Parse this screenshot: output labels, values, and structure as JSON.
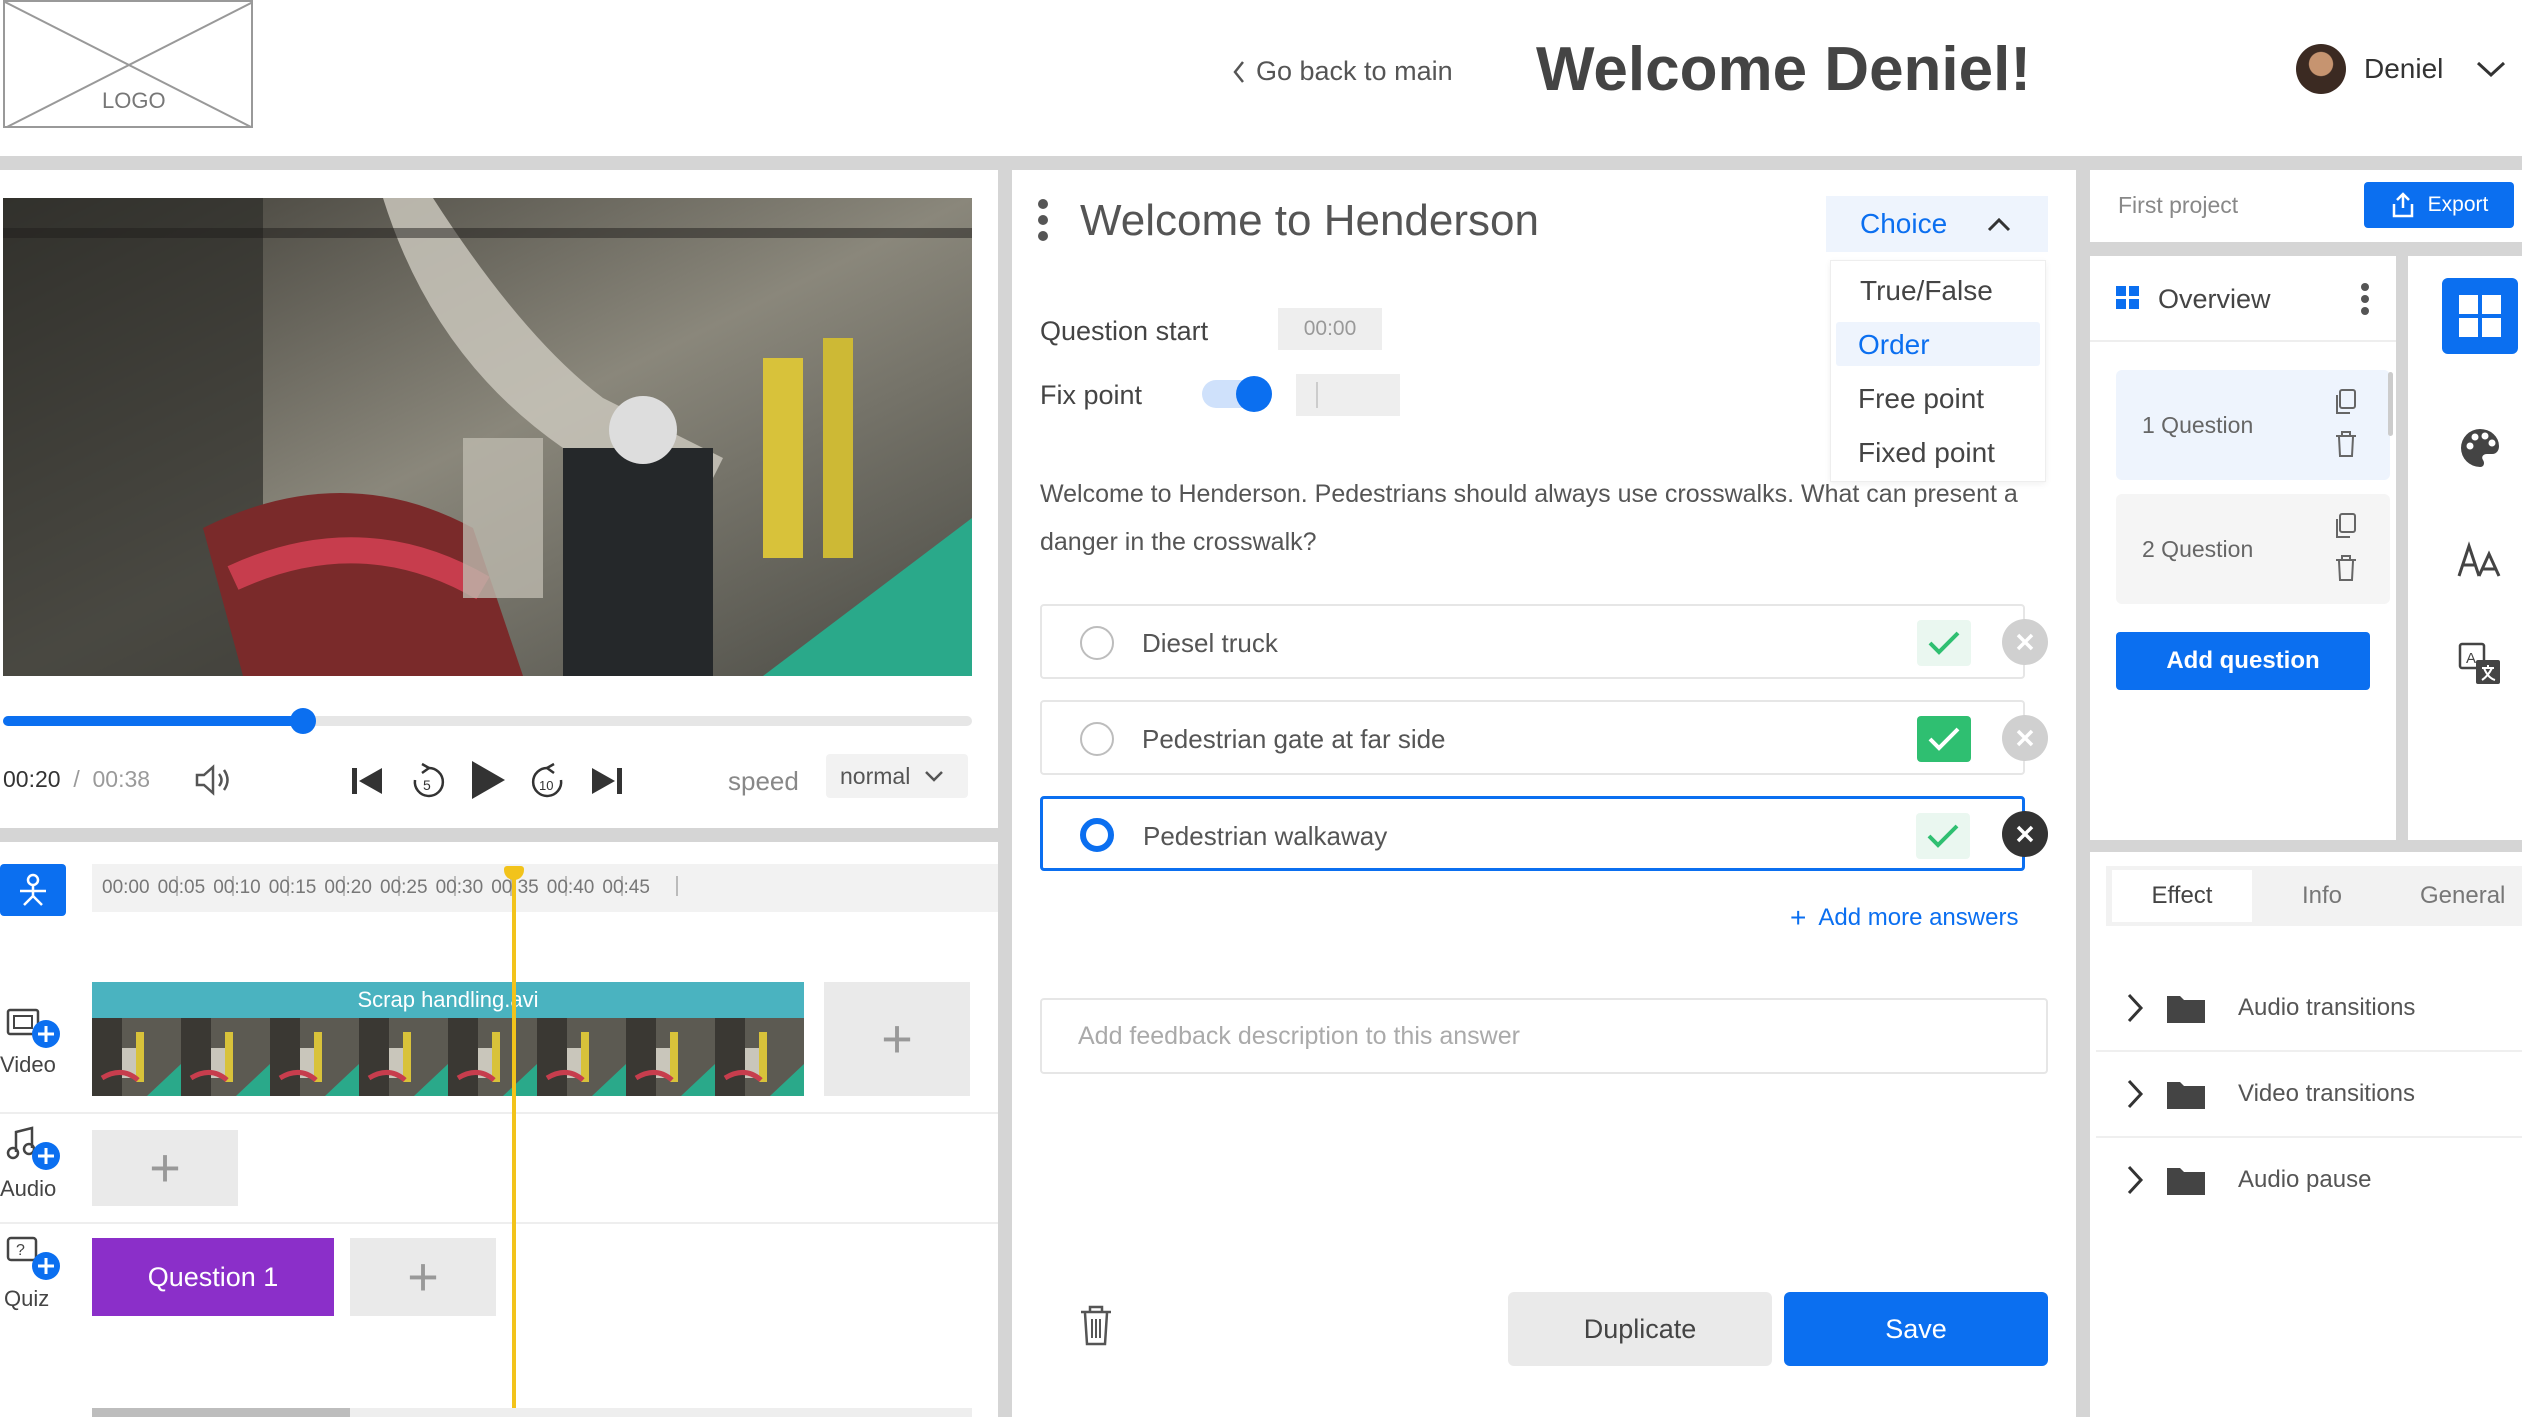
{
  "header": {
    "logo_text": "LOGO",
    "back_link": "Go back to main",
    "welcome": "Welcome Deniel!",
    "user_name": "Deniel"
  },
  "player": {
    "time_current": "00:20",
    "time_total": "00:38",
    "progress": 0.31,
    "speed_label": "speed",
    "speed_value": "normal",
    "skip_back_seconds": "5",
    "skip_fwd_seconds": "10"
  },
  "timeline": {
    "ticks": [
      "00:00",
      "00:05",
      "00:10",
      "00:15",
      "00:20",
      "00:25",
      "00:30",
      "00:35",
      "00:40",
      "00:45"
    ],
    "tracks": {
      "video": "Video",
      "audio": "Audio",
      "quiz": "Quiz"
    },
    "video_clip": "Scrap handling.avi",
    "quiz_clip": "Question 1"
  },
  "question": {
    "title": "Welcome to Henderson",
    "type_selected": "Choice",
    "type_options": [
      "True/False",
      "Order",
      "Free point",
      "Fixed point"
    ],
    "type_highlighted": "Order",
    "start_label": "Question start",
    "start_value": "00:00",
    "fix_point_label": "Fix point",
    "fix_point_on": true,
    "text": "Welcome to Henderson. Pedestrians should always use crosswalks. What can present a danger in the crosswalk?",
    "answers": [
      {
        "text": "Diesel truck",
        "correct": false,
        "selected": false
      },
      {
        "text": "Pedestrian gate at far side",
        "correct": true,
        "selected": false
      },
      {
        "text": "Pedestrian walkaway",
        "correct": false,
        "selected": true
      }
    ],
    "add_more": "Add more answers",
    "feedback_placeholder": "Add feedback description to this answer",
    "duplicate_label": "Duplicate",
    "save_label": "Save"
  },
  "project": {
    "name": "First project",
    "export_label": "Export",
    "overview_label": "Overview",
    "questions": [
      "1 Question",
      "2 Question"
    ],
    "add_question_label": "Add question"
  },
  "effects": {
    "tabs": [
      "Effect",
      "Info",
      "General"
    ],
    "active_tab": "Effect",
    "items": [
      "Audio transitions",
      "Video transitions",
      "Audio pause"
    ]
  },
  "colors": {
    "accent": "#0b6ff0",
    "check_green": "#2fbf71",
    "quiz_purple": "#8b2fc9",
    "clip_teal": "#4ab3c0",
    "playhead": "#f2c31b"
  }
}
